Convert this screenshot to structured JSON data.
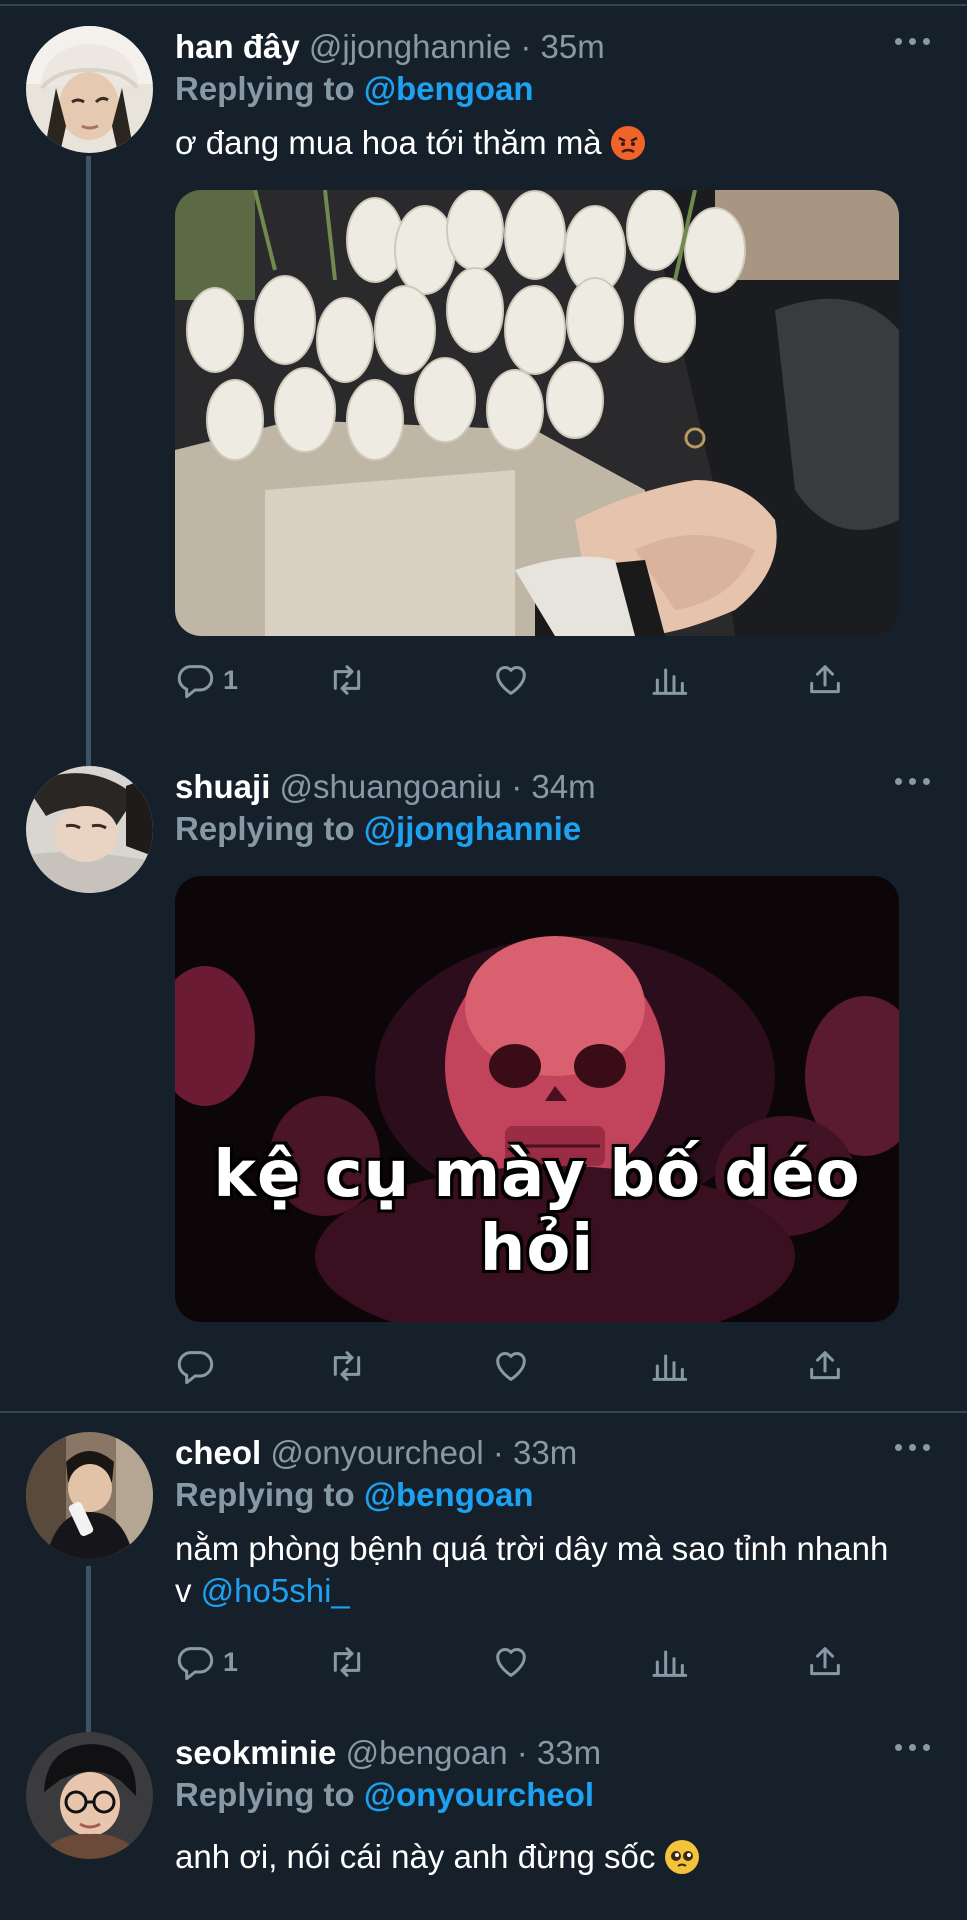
{
  "tweets": [
    {
      "name": "han đây",
      "handle": "@jjonghannie",
      "separator": "·",
      "time": "35m",
      "replying_label": "Replying to",
      "replying_to": "@bengoan",
      "text": "ơ đang mua hoa tới thăm mà",
      "text_emoji": "angry-face-emoji",
      "reply_count": "1",
      "media": "photo-white-tulips-holding-hands"
    },
    {
      "name": "shuaji",
      "handle": "@shuangoaniu",
      "separator": "·",
      "time": "34m",
      "replying_label": "Replying to",
      "replying_to": "@jjonghannie",
      "media": "meme-red-skeletons",
      "media_caption": "kệ cụ mày bố déo hỏi",
      "reply_count": ""
    },
    {
      "name": "cheol",
      "handle": "@onyourcheol",
      "separator": "·",
      "time": "33m",
      "replying_label": "Replying to",
      "replying_to": "@bengoan",
      "text": "nằm phòng bệnh quá trời dây mà sao tỉnh nhanh v",
      "text_link": "@ho5shi_",
      "reply_count": "1"
    },
    {
      "name": "seokminie",
      "handle": "@bengoan",
      "separator": "·",
      "time": "33m",
      "replying_label": "Replying to",
      "replying_to": "@onyourcheol",
      "text": "anh ơi, nói cái này anh đừng sốc",
      "text_emoji": "pleading-face-emoji"
    }
  ],
  "colors": {
    "background": "#15202b",
    "secondary_text": "#8899a6",
    "accent": "#1da1f2",
    "divider": "#38444d",
    "thread_line": "#3d5466"
  },
  "icons": {
    "reply": "reply-icon",
    "retweet": "retweet-icon",
    "like": "heart-icon",
    "analytics": "analytics-icon",
    "share": "share-icon",
    "more": "more-icon"
  }
}
